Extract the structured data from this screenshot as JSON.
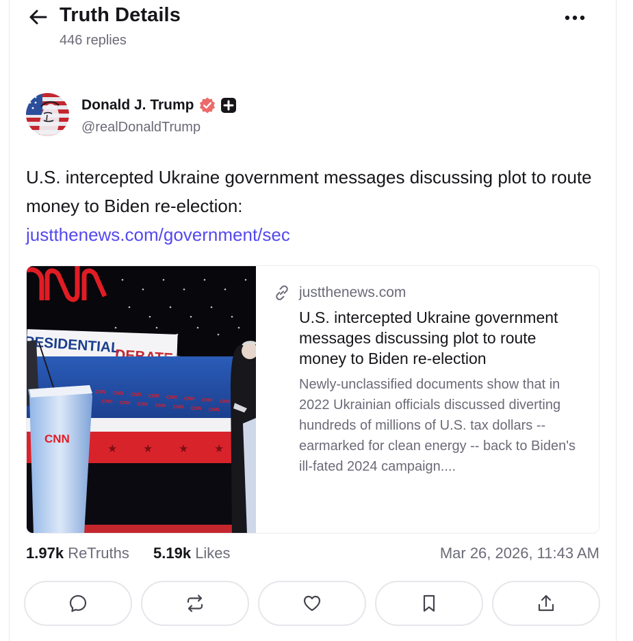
{
  "header": {
    "title": "Truth Details",
    "replies": "446 replies"
  },
  "author": {
    "name": "Donald J. Trump",
    "handle": "@realDonaldTrump",
    "verified": true
  },
  "post": {
    "text": "U.S. intercepted Ukraine government messages discussing plot to route money to Biden re-election:",
    "link": "justthenews.com/government/sec"
  },
  "card": {
    "domain": "justthenews.com",
    "title": "U.S. intercepted Ukraine government messages discussing plot to route money to Biden re-election",
    "description": "Newly-unclassified documents show that in 2022 Ukrainian officials discussed diverting hundreds of millions of U.S. tax dollars -- earmarked for clean energy -- back to Biden's ill-fated 2024 campaign....",
    "image_text": {
      "banner": "RESIDENTIAL DEBATE",
      "logo": "CNN",
      "podium_logo": "CNN",
      "backdrop_word": "CNN"
    }
  },
  "stats": {
    "retruths_count": "1.97k",
    "retruths_label": "ReTruths",
    "likes_count": "5.19k",
    "likes_label": "Likes",
    "timestamp": "Mar 26, 2026, 11:43 AM"
  },
  "actions": [
    "reply-icon",
    "retruth-icon",
    "like-icon",
    "bookmark-icon",
    "share-icon"
  ],
  "colors": {
    "link": "#5448ee",
    "verified_badge": "#ec6a6a",
    "muted_text": "#6b6b78"
  }
}
